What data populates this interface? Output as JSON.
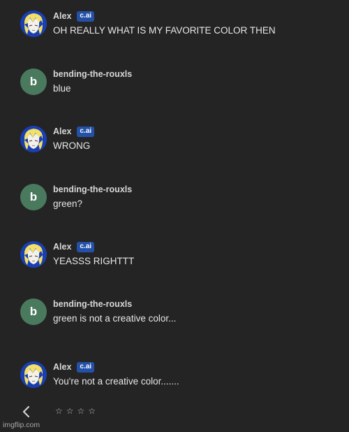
{
  "messages": [
    {
      "sender": "Alex",
      "badge": "c.ai",
      "role": "bot",
      "text": "OH REALLY WHAT IS MY FAVORITE COLOR THEN"
    },
    {
      "sender": "bending-the-rouxls",
      "initial": "b",
      "role": "user",
      "text": "blue"
    },
    {
      "sender": "Alex",
      "badge": "c.ai",
      "role": "bot",
      "text": "WRONG"
    },
    {
      "sender": "bending-the-rouxls",
      "initial": "b",
      "role": "user",
      "text": "green?"
    },
    {
      "sender": "Alex",
      "badge": "c.ai",
      "role": "bot",
      "text": "YEASSS RIGHTTT"
    },
    {
      "sender": "bending-the-rouxls",
      "initial": "b",
      "role": "user",
      "text": "green is not a creative color..."
    },
    {
      "sender": "Alex",
      "badge": "c.ai",
      "role": "bot",
      "text": "You're not a creative color......."
    }
  ],
  "footer": {
    "back_icon": "chevron-left-icon",
    "rating_icons": [
      "star-icon",
      "star-icon",
      "star-icon",
      "star-icon"
    ],
    "rating_glyph": "☆"
  },
  "watermark": "imgflip.com",
  "colors": {
    "background": "#242424",
    "user_avatar": "#4a7a5e",
    "bot_avatar": "#1a3fb0",
    "badge": "#2451a8"
  }
}
